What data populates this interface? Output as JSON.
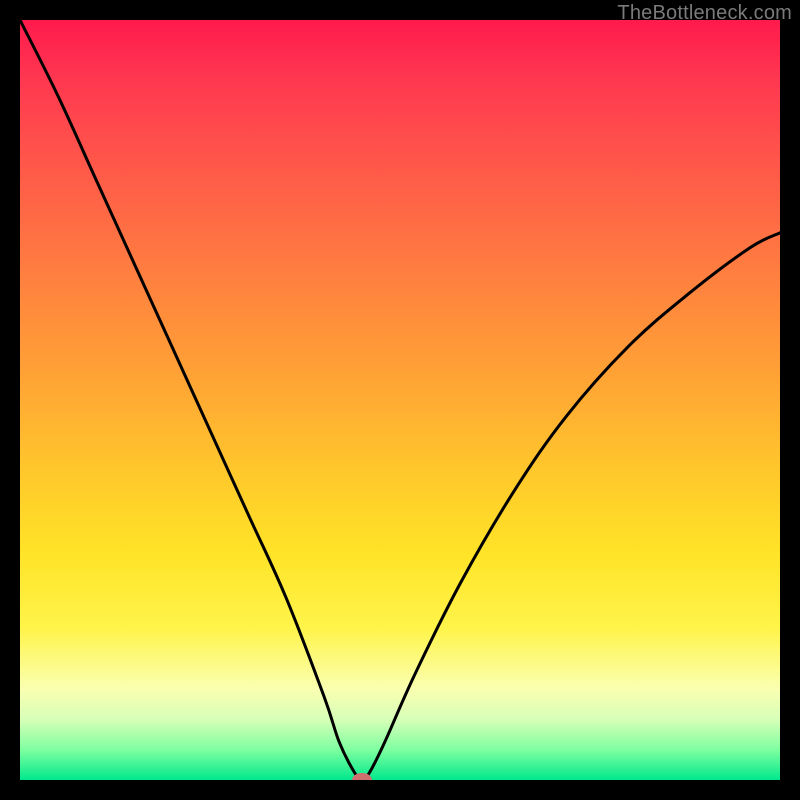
{
  "watermark": "TheBottleneck.com",
  "colors": {
    "frame": "#000000",
    "curve": "#000000",
    "marker": "#cf6f6e",
    "gradient_top": "#ff1a4d",
    "gradient_bottom": "#00e88c"
  },
  "chart_data": {
    "type": "line",
    "title": "",
    "xlabel": "",
    "ylabel": "",
    "xlim": [
      0,
      100
    ],
    "ylim": [
      0,
      100
    ],
    "grid": false,
    "legend": false,
    "series": [
      {
        "name": "bottleneck-curve",
        "x": [
          0,
          5,
          10,
          15,
          20,
          25,
          30,
          35,
          40,
          42,
          44,
          45,
          46,
          48,
          52,
          58,
          65,
          72,
          80,
          88,
          96,
          100
        ],
        "y": [
          100,
          90,
          79,
          68,
          57,
          46,
          35,
          24,
          11,
          5,
          1,
          0,
          1,
          5,
          14,
          26,
          38,
          48,
          57,
          64,
          70,
          72
        ]
      }
    ],
    "marker": {
      "x": 45,
      "y": 0
    },
    "annotations": []
  }
}
